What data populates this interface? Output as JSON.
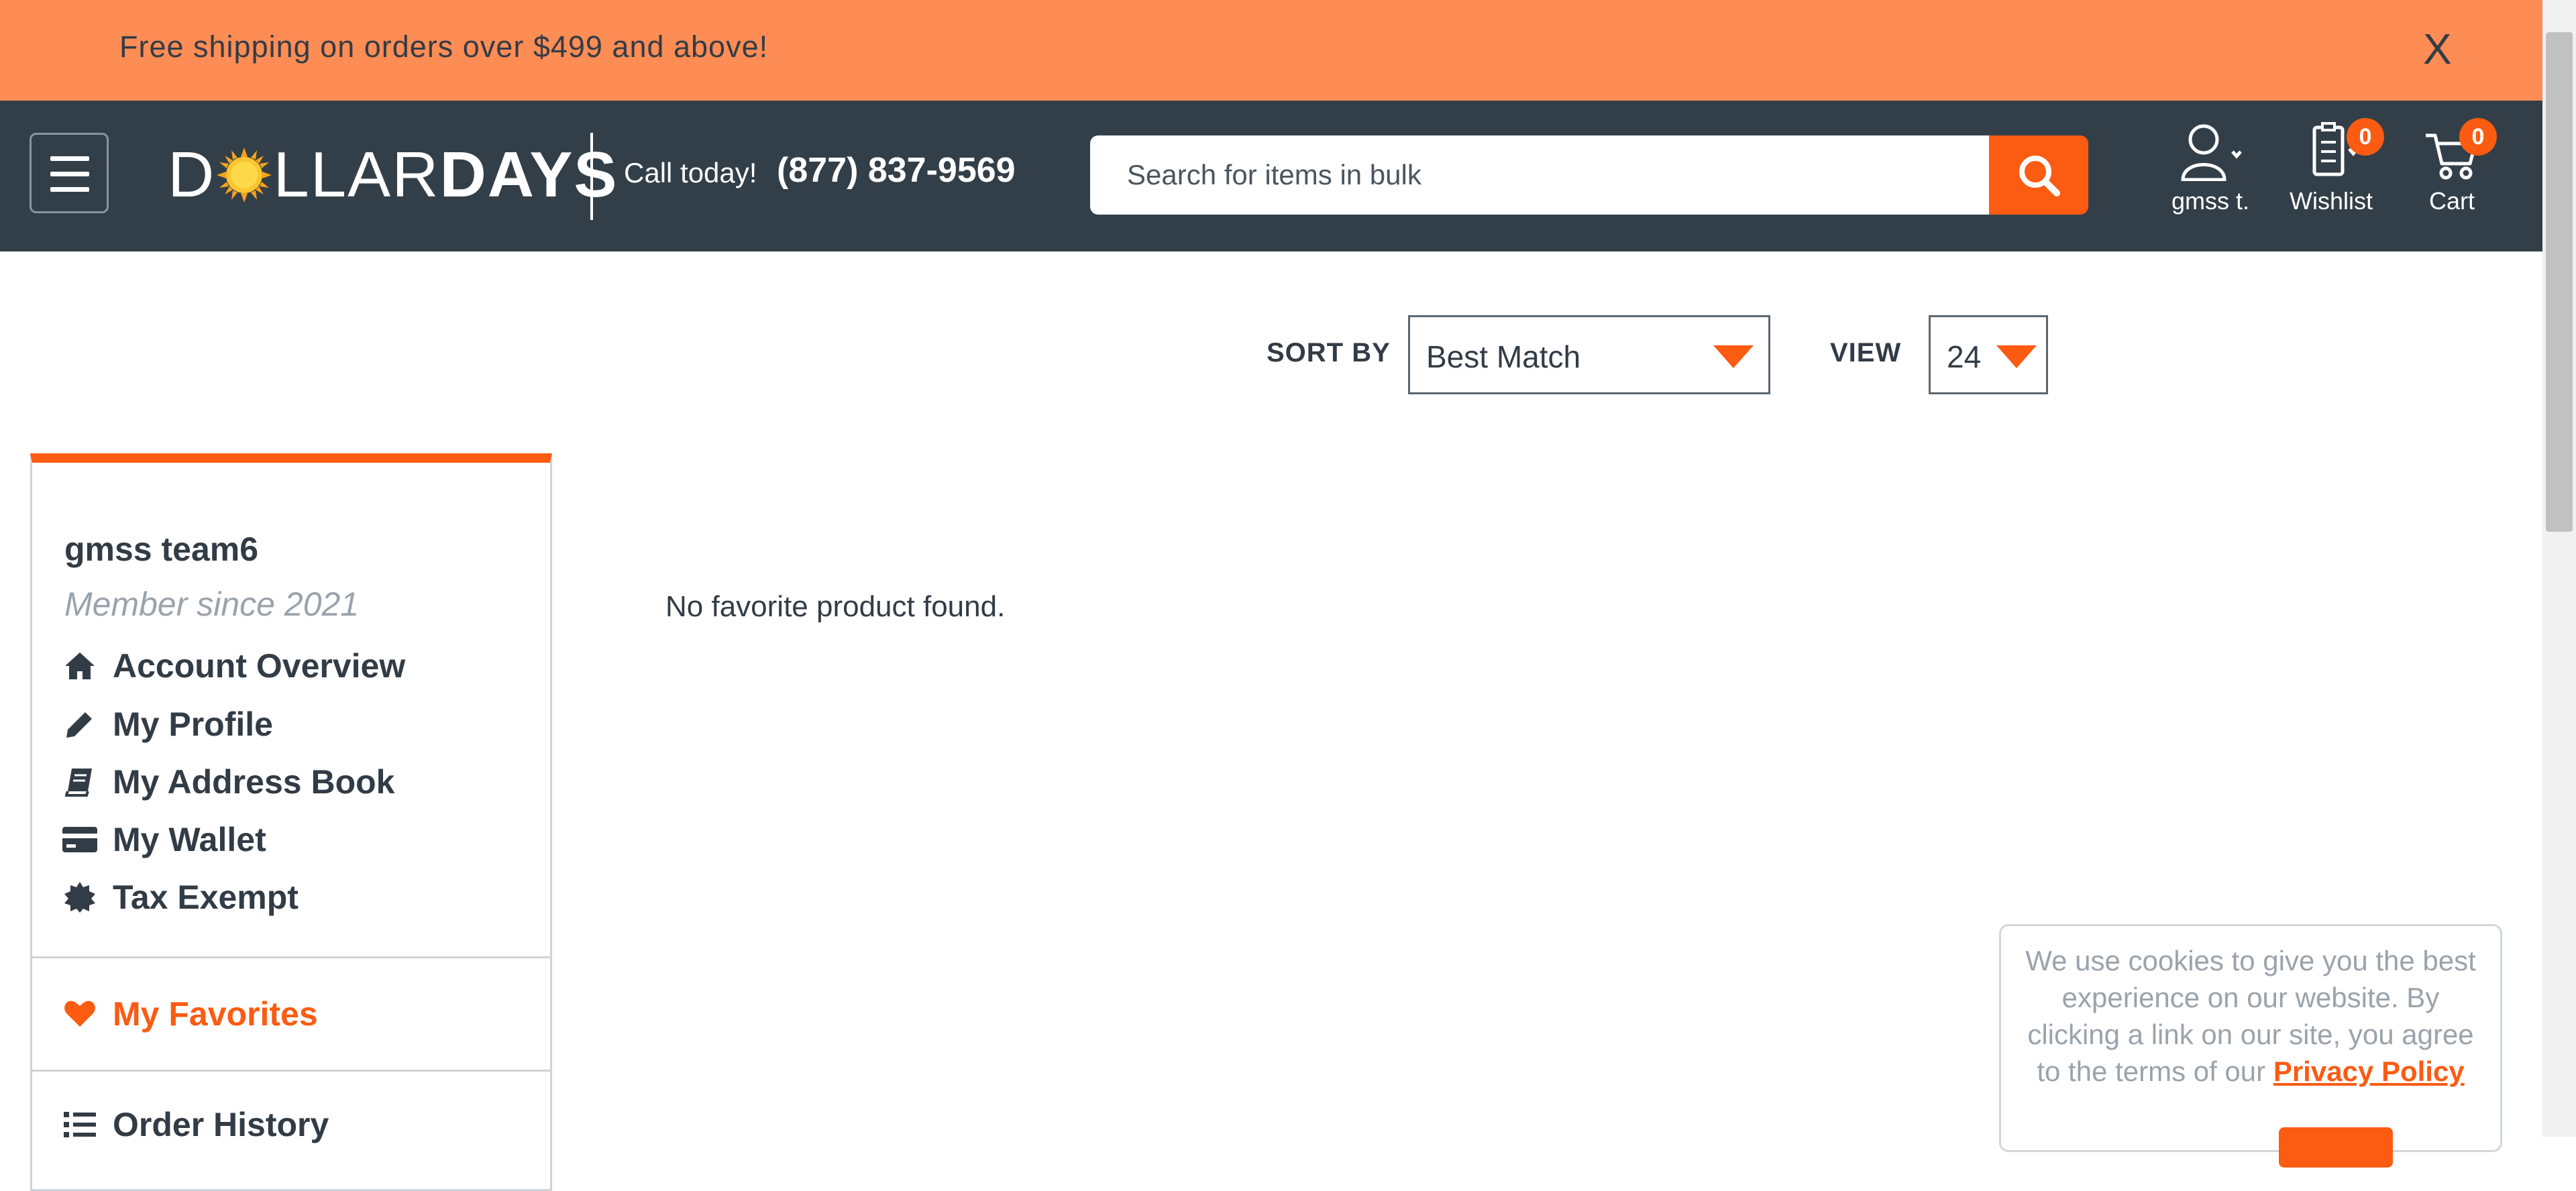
{
  "promo": {
    "text": "Free shipping on orders over $499 and above!",
    "close_label": "X"
  },
  "header": {
    "logo": {
      "part1": "D",
      "part2": "LLAR",
      "part3": "DAYS"
    },
    "call_label": "Call today!",
    "phone": "(877) 837-9569",
    "search_placeholder": "Search for items in bulk",
    "account_label": "gmss t.",
    "wishlist_label": "Wishlist",
    "wishlist_count": "0",
    "cart_label": "Cart",
    "cart_count": "0"
  },
  "toolbar": {
    "sort_label": "SORT BY",
    "sort_value": "Best Match",
    "view_label": "VIEW",
    "view_value": "24"
  },
  "sidebar": {
    "user_name": "gmss team6",
    "member_since": "Member since 2021",
    "items": [
      {
        "label": "Account Overview",
        "icon": "home-icon"
      },
      {
        "label": "My Profile",
        "icon": "pencil-icon"
      },
      {
        "label": "My Address Book",
        "icon": "book-icon"
      },
      {
        "label": "My Wallet",
        "icon": "credit-card-icon"
      },
      {
        "label": "Tax Exempt",
        "icon": "certificate-icon"
      }
    ],
    "favorites_label": "My Favorites",
    "order_history_label": "Order History"
  },
  "main": {
    "empty_message": "No favorite product found."
  },
  "cookie": {
    "text": "We use cookies to give you the best experience on our website. By clicking a link on our site, you agree to the terms of our",
    "link_label": "Privacy Policy"
  },
  "colors": {
    "accent": "#fc5b12",
    "promo_bg": "#fd8c55",
    "header_bg": "#333f48",
    "text": "#323c46"
  }
}
